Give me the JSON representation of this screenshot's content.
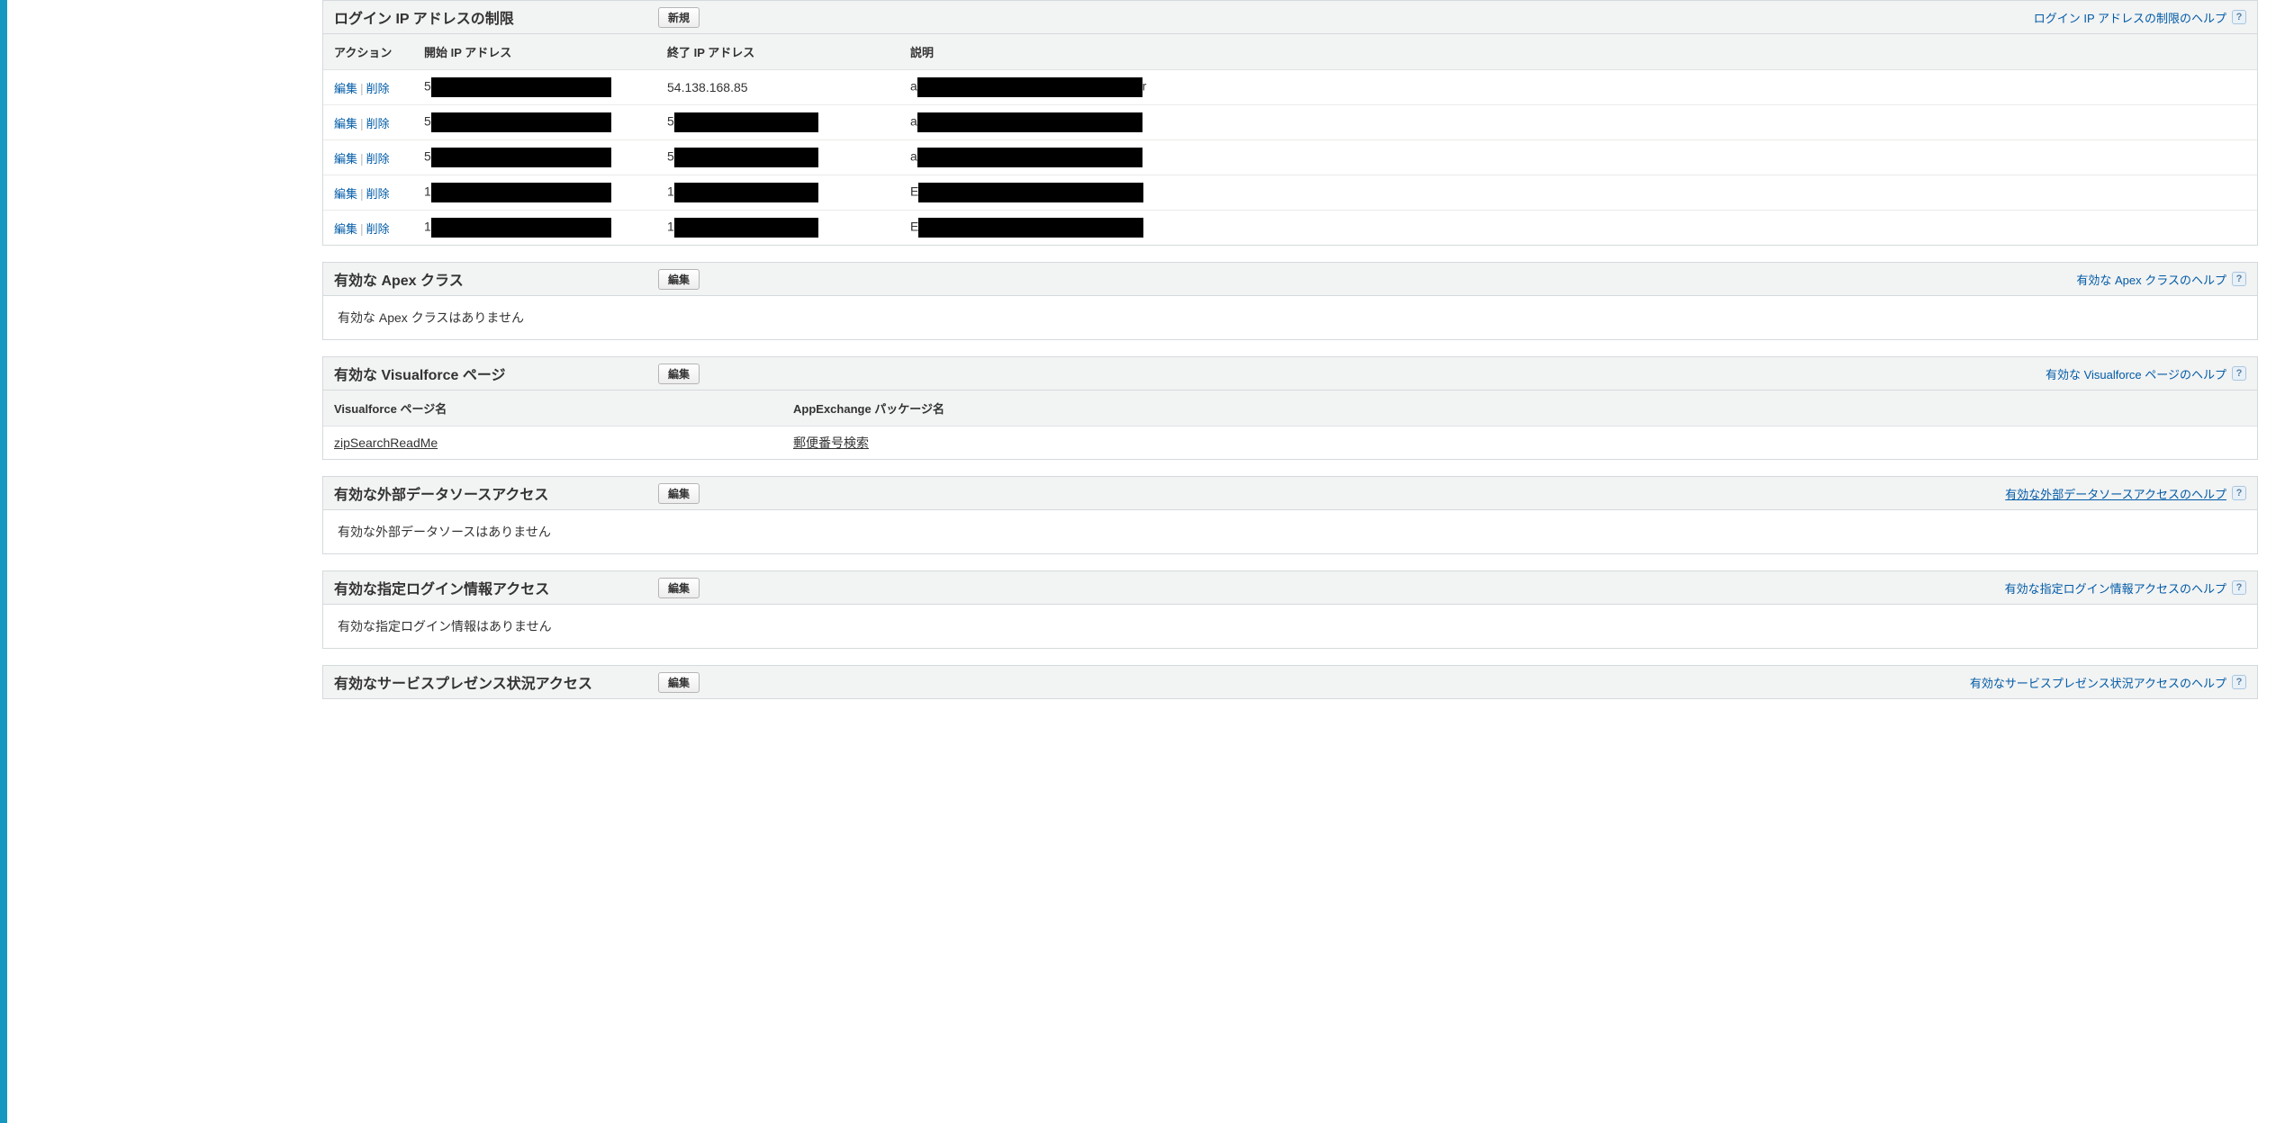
{
  "ip_section": {
    "title": "ログイン IP アドレスの制限",
    "new_button": "新規",
    "help_link": "ログイン IP アドレスの制限のヘルプ",
    "columns": {
      "action": "アクション",
      "start_ip": "開始 IP アドレス",
      "end_ip": "終了 IP アドレス",
      "description": "説明"
    },
    "actions": {
      "edit": "編集",
      "delete": "削除"
    },
    "rows": [
      {
        "start_prefix": "5",
        "end_prefix": "54.138.168.85",
        "desc_prefix": "a",
        "desc_suffix": "r"
      },
      {
        "start_prefix": "5",
        "end_prefix": "5",
        "desc_prefix": "a",
        "desc_suffix": ""
      },
      {
        "start_prefix": "5",
        "end_prefix": "5",
        "desc_prefix": "a",
        "desc_suffix": ""
      },
      {
        "start_prefix": "1",
        "end_prefix": "1",
        "desc_prefix": "E",
        "desc_suffix": ""
      },
      {
        "start_prefix": "1",
        "end_prefix": "1",
        "desc_prefix": "E",
        "desc_suffix": ""
      }
    ]
  },
  "apex_section": {
    "title": "有効な Apex クラス",
    "edit_button": "編集",
    "help_link": "有効な Apex クラスのヘルプ",
    "empty_text": "有効な Apex クラスはありません"
  },
  "vf_section": {
    "title": "有効な Visualforce ページ",
    "edit_button": "編集",
    "help_link": "有効な Visualforce ページのヘルプ",
    "columns": {
      "page_name": "Visualforce ページ名",
      "package_name": "AppExchange パッケージ名"
    },
    "rows": [
      {
        "page_name": "zipSearchReadMe",
        "package_name": "郵便番号検索"
      }
    ]
  },
  "extds_section": {
    "title": "有効な外部データソースアクセス",
    "edit_button": "編集",
    "help_link": "有効な外部データソースアクセスのヘルプ",
    "empty_text": "有効な外部データソースはありません"
  },
  "cred_section": {
    "title": "有効な指定ログイン情報アクセス",
    "edit_button": "編集",
    "help_link": "有効な指定ログイン情報アクセスのヘルプ",
    "empty_text": "有効な指定ログイン情報はありません"
  },
  "service_section": {
    "title": "有効なサービスプレゼンス状況アクセス",
    "edit_button": "編集",
    "help_link": "有効なサービスプレゼンス状況アクセスのヘルプ"
  }
}
